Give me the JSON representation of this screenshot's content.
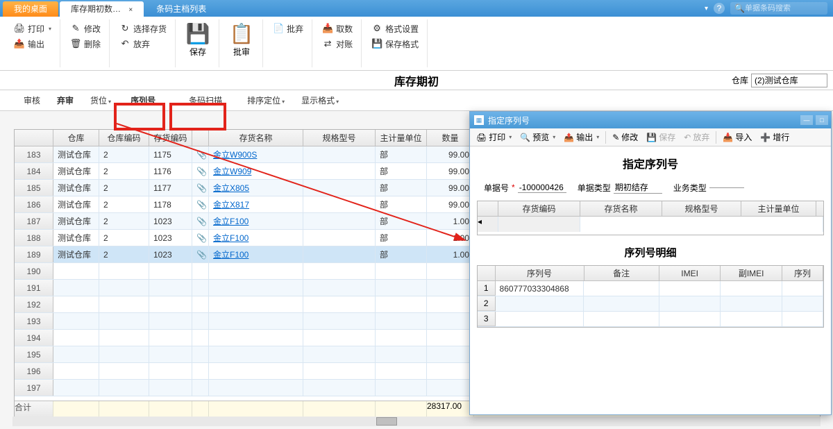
{
  "tabs": {
    "desktop": "我的桌面",
    "inventory": "库存期初数…",
    "barcode": "条码主档列表"
  },
  "search": {
    "placeholder": "单据条码搜索"
  },
  "ribbon": {
    "print": "打印",
    "modify": "修改",
    "select_goods": "选择存货",
    "output": "输出",
    "delete": "删除",
    "discard": "放弃",
    "save": "保存",
    "approve": "批审",
    "approve_big": "批弃",
    "fetch": "取数",
    "format": "格式设置",
    "reconcile": "对账",
    "save_format": "保存格式"
  },
  "page_title": "库存期初",
  "warehouse": {
    "label": "仓库",
    "value": "(2)测试仓库"
  },
  "subbar": {
    "audit": "审核",
    "abandon": "弃审",
    "location": "货位",
    "serial": "序列号",
    "scan": "条码扫描",
    "sort": "排序定位",
    "display": "显示格式"
  },
  "grid": {
    "headers": {
      "warehouse": "仓库",
      "wh_code": "仓库编码",
      "goods_code": "存货编码",
      "goods_name": "存货名称",
      "spec": "规格型号",
      "unit": "主计量单位",
      "qty": "数量"
    },
    "rows": [
      {
        "idx": "183",
        "wh": "测试仓库",
        "whc": "2",
        "gc": "1175",
        "gn": "金立W900S",
        "unit": "部",
        "qty": "99.00"
      },
      {
        "idx": "184",
        "wh": "测试仓库",
        "whc": "2",
        "gc": "1176",
        "gn": "金立W909",
        "unit": "部",
        "qty": "99.00"
      },
      {
        "idx": "185",
        "wh": "测试仓库",
        "whc": "2",
        "gc": "1177",
        "gn": "金立X805",
        "unit": "部",
        "qty": "99.00"
      },
      {
        "idx": "186",
        "wh": "测试仓库",
        "whc": "2",
        "gc": "1178",
        "gn": "金立X817",
        "unit": "部",
        "qty": "99.00"
      },
      {
        "idx": "187",
        "wh": "测试仓库",
        "whc": "2",
        "gc": "1023",
        "gn": "金立F100",
        "unit": "部",
        "qty": "1.00"
      },
      {
        "idx": "188",
        "wh": "测试仓库",
        "whc": "2",
        "gc": "1023",
        "gn": "金立F100",
        "unit": "部",
        "qty": "1.00"
      },
      {
        "idx": "189",
        "wh": "测试仓库",
        "whc": "2",
        "gc": "1023",
        "gn": "金立F100",
        "unit": "部",
        "qty": "1.00",
        "sel": true
      },
      {
        "idx": "190"
      },
      {
        "idx": "191"
      },
      {
        "idx": "192"
      },
      {
        "idx": "193"
      },
      {
        "idx": "194"
      },
      {
        "idx": "195"
      },
      {
        "idx": "196"
      },
      {
        "idx": "197"
      }
    ],
    "footer": {
      "label": "合计",
      "total": "28317.00"
    }
  },
  "dialog": {
    "title": "指定序列号",
    "toolbar": {
      "print": "打印",
      "preview": "预览",
      "output": "输出",
      "modify": "修改",
      "save": "保存",
      "discard": "放弃",
      "import": "导入",
      "addrow": "增行"
    },
    "heading": "指定序列号",
    "fields": {
      "docno_label": "单据号",
      "docno": "-100000426",
      "type_label": "单据类型",
      "type": "期初结存",
      "biz_label": "业务类型"
    },
    "grid1_headers": {
      "code": "存货编码",
      "name": "存货名称",
      "spec": "规格型号",
      "unit": "主计量单位"
    },
    "subheading": "序列号明细",
    "grid2_headers": {
      "serial": "序列号",
      "note": "备注",
      "imei": "IMEI",
      "sub_imei": "副IMEI",
      "serial2": "序列"
    },
    "grid2_rows": [
      {
        "n": "1",
        "serial": "860777033304868"
      },
      {
        "n": "2",
        "serial": ""
      },
      {
        "n": "3",
        "serial": ""
      }
    ]
  }
}
